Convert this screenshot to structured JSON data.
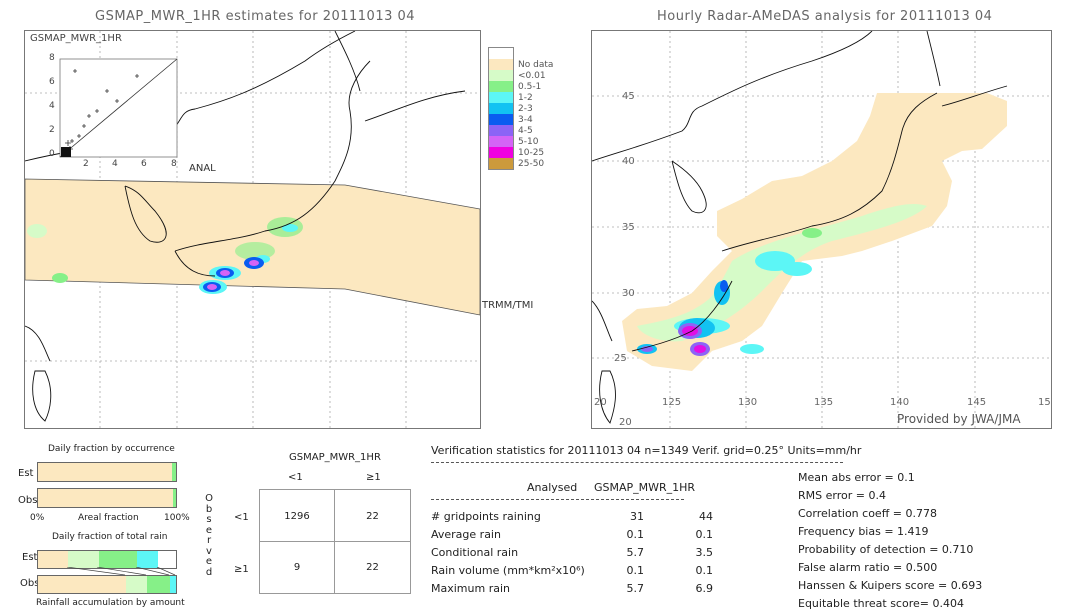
{
  "left_map": {
    "title": "GSMAP_MWR_1HR estimates for 20111013 04",
    "inset_label": "GSMAP_MWR_1HR",
    "inset_y_ticks": [
      "8",
      "6",
      "4",
      "2",
      "0"
    ],
    "inset_x_ticks": [
      "2",
      "4",
      "6",
      "8"
    ],
    "x_axis_label": "ANAL",
    "swath_label": "TRMM/TMI"
  },
  "right_map": {
    "title": "Hourly Radar-AMeDAS analysis for 20111013 04",
    "lat_labels": [
      "45",
      "40",
      "35",
      "30",
      "25",
      "20"
    ],
    "lon_labels": [
      "20",
      "125",
      "130",
      "135",
      "140",
      "145",
      "15"
    ],
    "credit": "Provided by JWA/JMA"
  },
  "legend": {
    "items": [
      {
        "label": "",
        "color": "#ffffff"
      },
      {
        "label": "No data",
        "color": "#fce8c0"
      },
      {
        "label": "<0.01",
        "color": "#d6fbc8"
      },
      {
        "label": "0.5-1",
        "color": "#86f088"
      },
      {
        "label": "1-2",
        "color": "#5cf6f6"
      },
      {
        "label": "2-3",
        "color": "#12c2f2"
      },
      {
        "label": "3-4",
        "color": "#0a5cf0"
      },
      {
        "label": "4-5",
        "color": "#8c64f6"
      },
      {
        "label": "5-10",
        "color": "#d464f6"
      },
      {
        "label": "10-25",
        "color": "#f000e0"
      },
      {
        "label": "25-50",
        "color": "#cc9a3c"
      }
    ]
  },
  "occurrence": {
    "title": "Daily fraction by occurrence",
    "est_label": "Est",
    "obs_label": "Obs",
    "axis_left": "0%",
    "axis_center": "Areal fraction",
    "axis_right": "100%",
    "est_fractions": [
      0.97,
      0.03
    ],
    "obs_fractions": [
      0.975,
      0.025
    ]
  },
  "total_rain": {
    "title": "Daily fraction of total rain",
    "est_label": "Est",
    "obs_label": "Obs",
    "footer": "Rainfall accumulation by amount",
    "est_segments": [
      0.22,
      0.22,
      0.28,
      0.15
    ],
    "obs_segments": [
      0.64,
      0.15,
      0.17,
      0.04
    ]
  },
  "contingency": {
    "col_header": "GSMAP_MWR_1HR",
    "col_labels": [
      "<1",
      "≥1"
    ],
    "row_header": "Observed",
    "row_labels": [
      "<1",
      "≥1"
    ],
    "cells": [
      [
        "1296",
        "22"
      ],
      [
        "9",
        "22"
      ]
    ]
  },
  "verification": {
    "header": "Verification statistics for 20111013 04   n=1349   Verif. grid=0.25°   Units=mm/hr",
    "col_analysed": "Analysed",
    "col_model": "GSMAP_MWR_1HR",
    "rows": [
      {
        "label": "# gridpoints raining",
        "analysed": "31",
        "model": "44"
      },
      {
        "label": "Average rain",
        "analysed": "0.1",
        "model": "0.1"
      },
      {
        "label": "Conditional rain",
        "analysed": "5.7",
        "model": "3.5"
      },
      {
        "label": "Rain volume (mm*km²x10⁶)",
        "analysed": "0.1",
        "model": "0.1"
      },
      {
        "label": "Maximum rain",
        "analysed": "5.7",
        "model": "6.9"
      }
    ],
    "scores": [
      "Mean abs error = 0.1",
      "RMS error = 0.4",
      "Correlation coeff = 0.778",
      "Frequency bias = 1.419",
      "Probability of detection = 0.710",
      "False alarm ratio = 0.500",
      "Hanssen & Kuipers score = 0.693",
      "Equitable threat score= 0.404"
    ]
  }
}
